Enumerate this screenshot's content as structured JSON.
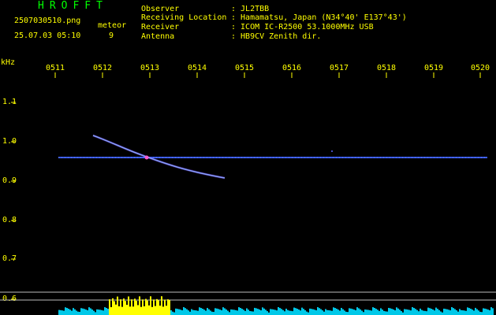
{
  "app": {
    "title": "HROFFT",
    "filename": "2507030510.png",
    "datetime": "25.07.03 05:10",
    "meteor_label": "meteor",
    "meteor_count": "9"
  },
  "station": {
    "rows": [
      {
        "key": "Observer",
        "value": ": JL2TBB"
      },
      {
        "key": "Receiving Location",
        "value": ": Hamamatsu, Japan (N34°40' E137°43')"
      },
      {
        "key": "Receiver",
        "value": ": ICOM IC-R2500 53.1000MHz USB"
      },
      {
        "key": "Antenna",
        "value": ": HB9CV Zenith dir."
      }
    ]
  },
  "axis": {
    "unit": "kHz",
    "time_ticks": [
      "0511",
      "0512",
      "0513",
      "0514",
      "0515",
      "0516",
      "0517",
      "0518",
      "0519",
      "0520"
    ],
    "freq_ticks": [
      "1.1",
      "1.0",
      "0.9",
      "0.8",
      "0.7",
      "0.6"
    ]
  },
  "colors": {
    "text": "#ffff00",
    "title": "#00ff00",
    "beacon": "#3a5cff",
    "meteor": "#8fd8ff",
    "noise": "#00c8e8",
    "burst": "#ffff00"
  }
}
